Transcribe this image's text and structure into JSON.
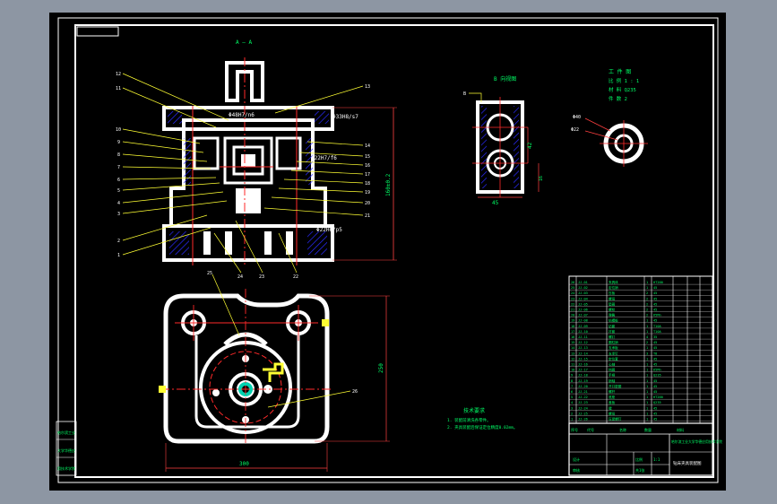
{
  "view_labels": {
    "section_view": "A — A",
    "side_view": "B 向视图",
    "part_title": "工 件 图",
    "part_scale": "比 例  1 : 1",
    "part_material": "材 料  Q235",
    "part_count": "件 数  2"
  },
  "fits": {
    "fit_top": "Φ48H7/n6",
    "fit_top_right": "Φ33H8/s7",
    "fit_mid": "Φ22H7/f6",
    "fit_bottom": "Φ22H6/p5"
  },
  "dimensions": {
    "height_left": "160±0.2",
    "side_width": "45",
    "side_height": "42",
    "side_depth": "16",
    "part_outer": "Φ40",
    "part_inner": "Φ22",
    "plan_width": "300",
    "plan_height": "250"
  },
  "balloons": {
    "left": [
      "12",
      "11",
      "10",
      "9",
      "8",
      "7",
      "6",
      "5",
      "4",
      "3",
      "2",
      "1"
    ],
    "right": [
      "13",
      "14",
      "15",
      "16",
      "17",
      "18",
      "19",
      "20",
      "21"
    ],
    "bottom": [
      "24",
      "23",
      "22"
    ],
    "plan_top": "25",
    "plan_right": "26"
  },
  "notes": {
    "heading": "技术要求",
    "line1": "1. 装配前清洗各零件。",
    "line2": "2. 夹具装配后保证定位精度0.02mm。"
  },
  "bom_rows": [
    {
      "code": "JJ-01",
      "name": "夹具体",
      "qty": "1",
      "mat": "HT200"
    },
    {
      "code": "JJ-02",
      "name": "定位销",
      "qty": "1",
      "mat": "45"
    },
    {
      "code": "JJ-03",
      "name": "压板",
      "qty": "2",
      "mat": "45"
    },
    {
      "code": "JJ-04",
      "name": "螺母",
      "qty": "2",
      "mat": "45"
    },
    {
      "code": "JJ-05",
      "name": "垫圈",
      "qty": "2",
      "mat": "45"
    },
    {
      "code": "JJ-06",
      "name": "螺栓",
      "qty": "2",
      "mat": "45"
    },
    {
      "code": "JJ-07",
      "name": "弹簧",
      "qty": "2",
      "mat": "65Mn"
    },
    {
      "code": "JJ-08",
      "name": "钻模板",
      "qty": "1",
      "mat": "45"
    },
    {
      "code": "JJ-09",
      "name": "钻套",
      "qty": "1",
      "mat": "T10A"
    },
    {
      "code": "JJ-10",
      "name": "衬套",
      "qty": "1",
      "mat": "T10A"
    },
    {
      "code": "JJ-11",
      "name": "螺钉",
      "qty": "4",
      "mat": "35"
    },
    {
      "code": "JJ-12",
      "name": "圆柱销",
      "qty": "2",
      "mat": "45"
    },
    {
      "code": "JJ-13",
      "name": "支承板",
      "qty": "1",
      "mat": "45"
    },
    {
      "code": "JJ-14",
      "name": "支承钉",
      "qty": "3",
      "mat": "T8"
    },
    {
      "code": "JJ-15",
      "name": "定位套",
      "qty": "1",
      "mat": "45"
    },
    {
      "code": "JJ-16",
      "name": "心轴",
      "qty": "1",
      "mat": "45"
    },
    {
      "code": "JJ-17",
      "name": "挡圈",
      "qty": "1",
      "mat": "65Mn"
    },
    {
      "code": "JJ-18",
      "name": "手柄",
      "qty": "1",
      "mat": "Q235"
    },
    {
      "code": "JJ-19",
      "name": "销轴",
      "qty": "1",
      "mat": "45"
    },
    {
      "code": "JJ-20",
      "name": "开口垫圈",
      "qty": "1",
      "mat": "45"
    },
    {
      "code": "JJ-21",
      "name": "螺杆",
      "qty": "1",
      "mat": "45"
    },
    {
      "code": "JJ-22",
      "name": "底座",
      "qty": "1",
      "mat": "HT200"
    },
    {
      "code": "JJ-23",
      "name": "盖板",
      "qty": "1",
      "mat": "Q235"
    },
    {
      "code": "JJ-24",
      "name": "键",
      "qty": "1",
      "mat": "45"
    },
    {
      "code": "JJ-25",
      "name": "螺母",
      "qty": "1",
      "mat": "45"
    },
    {
      "code": "JJ-26",
      "name": "压紧螺钉",
      "qty": "1",
      "mat": "45"
    }
  ],
  "title_block": {
    "school": "哈尔滨工业大学华德应用技术学院",
    "drawing_title": "钻床夹具装配图",
    "drawn": "设计",
    "checked": "审核",
    "scale": "1:1",
    "sheet": "共1张",
    "ratio": "比例",
    "header_no": "序号",
    "header_code": "代号",
    "header_name": "名称",
    "header_qty": "数量",
    "header_mat": "材料"
  },
  "side_stamp": {
    "line1": "哈尔滨工业",
    "line2": "大学华德应",
    "line3": "用技术学院"
  },
  "colors": {
    "line": "#ffffff",
    "text": "#00ff66",
    "center": "#ff2a2a",
    "hatch": "#2a2aff",
    "leader": "#ffff33",
    "dim": "#ff4040",
    "bg": "#000000"
  }
}
